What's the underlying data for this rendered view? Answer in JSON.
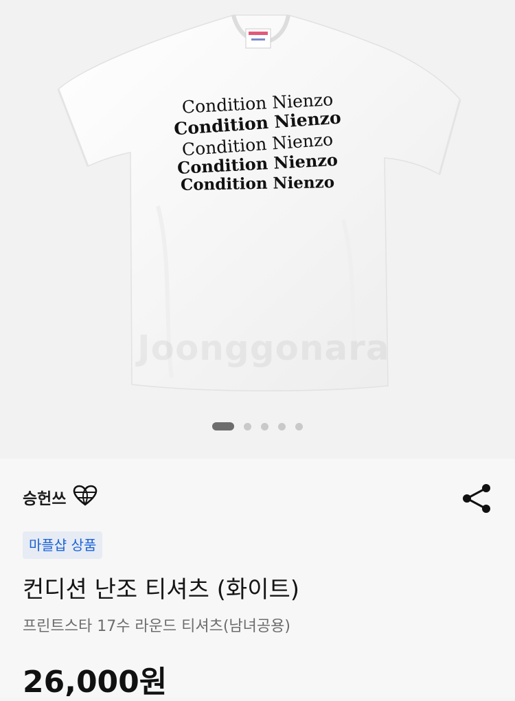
{
  "product_image": {
    "shirt_print_lines": [
      "Condition Nienzo",
      "Condition Nienzo",
      "Condition Nienzo",
      "Condition Nienzo",
      "Condition Nienzo"
    ],
    "watermark": "Joonggonara",
    "carousel": {
      "total": 5,
      "active_index": 0
    }
  },
  "seller": {
    "name": "승헌쓰",
    "badge_icon": "heart-globe-icon"
  },
  "share": {
    "icon": "share-icon"
  },
  "product": {
    "badge": "마플샵 상품",
    "title": "컨디션 난조 티셔츠 (화이트)",
    "subtitle": "프린트스타 17수 라운드 티셔츠(남녀공용)",
    "price": "26,000원"
  }
}
